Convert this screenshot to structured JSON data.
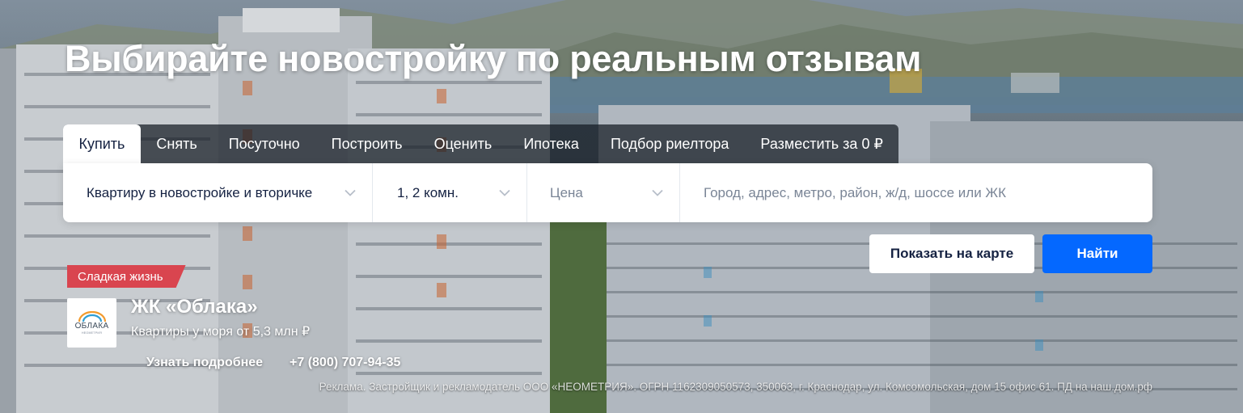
{
  "hero": {
    "headline": "Выбирайте новостройку по реальным отзывам"
  },
  "tabs": [
    {
      "label": "Купить",
      "active": true
    },
    {
      "label": "Снять",
      "active": false
    },
    {
      "label": "Посуточно",
      "active": false
    },
    {
      "label": "Построить",
      "active": false
    },
    {
      "label": "Оценить",
      "active": false
    },
    {
      "label": "Ипотека",
      "active": false
    },
    {
      "label": "Подбор риелтора",
      "active": false
    },
    {
      "label": "Разместить за 0 ₽",
      "active": false
    }
  ],
  "search": {
    "property_type": "Квартиру в новостройке и вторичке",
    "rooms": "1, 2 комн.",
    "price": "Цена",
    "location_placeholder": "Город, адрес, метро, район, ж/д, шоссе или ЖК"
  },
  "actions": {
    "show_on_map": "Показать на карте",
    "find": "Найти"
  },
  "promo": {
    "badge": "Сладкая жизнь",
    "logo_text": "ОБЛАКА",
    "logo_subtext": "НЕОМЕТРИЯ",
    "title": "ЖК «Облака»",
    "subtitle": "Квартиры у моря от 5,3 млн ₽",
    "more_link": "Узнать подробнее",
    "phone": "+7 (800) 707-94-35",
    "disclaimer": "Реклама. Застройщик и рекламодатель ООО «НЕОМЕТРИЯ». ОГРН 1162309050573, 350063, г. Краснодар, ул. Комсомольская, дом 15 офис 61. ПД на наш.дом.рф"
  },
  "colors": {
    "accent_blue": "#0468ff",
    "badge_red": "#d9454f",
    "text_dark": "#152242"
  },
  "icons": {
    "dropdown": "chevron-down-icon"
  }
}
